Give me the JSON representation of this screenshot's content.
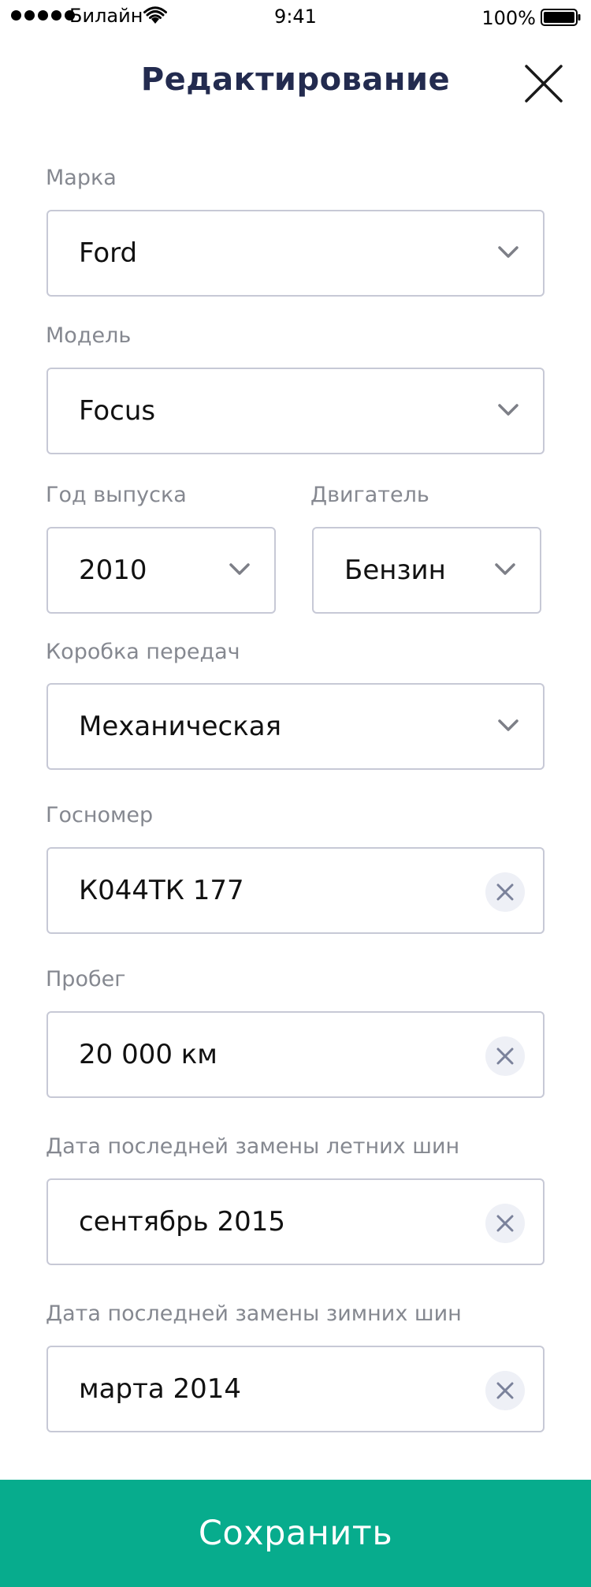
{
  "status_bar": {
    "carrier": "Билайн",
    "time": "9:41",
    "battery": "100%"
  },
  "header": {
    "title": "Редактирование",
    "close_icon": "close-icon"
  },
  "form": {
    "brand": {
      "label": "Марка",
      "value": "Ford"
    },
    "model": {
      "label": "Модель",
      "value": "Focus"
    },
    "year": {
      "label": "Год выпуска",
      "value": "2010"
    },
    "engine": {
      "label": "Двигатель",
      "value": "Бензин"
    },
    "transmission": {
      "label": "Коробка передач",
      "value": "Механическая"
    },
    "plate": {
      "label": "Госномер",
      "value": "К044ТК 177"
    },
    "mileage": {
      "label": "Пробег",
      "value": "20 000 км"
    },
    "summer_tires": {
      "label": "Дата последней замены летних шин",
      "value": "сентябрь 2015"
    },
    "winter_tires": {
      "label": "Дата последней замены зимних шин",
      "value": "марта 2014"
    }
  },
  "actions": {
    "save_label": "Сохранить"
  },
  "colors": {
    "title": "#232b4f",
    "label": "#858890",
    "border": "#c7c9d6",
    "accent": "#07ac8d",
    "clear_bg": "#eef0f6",
    "clear_x": "#7b829b"
  }
}
